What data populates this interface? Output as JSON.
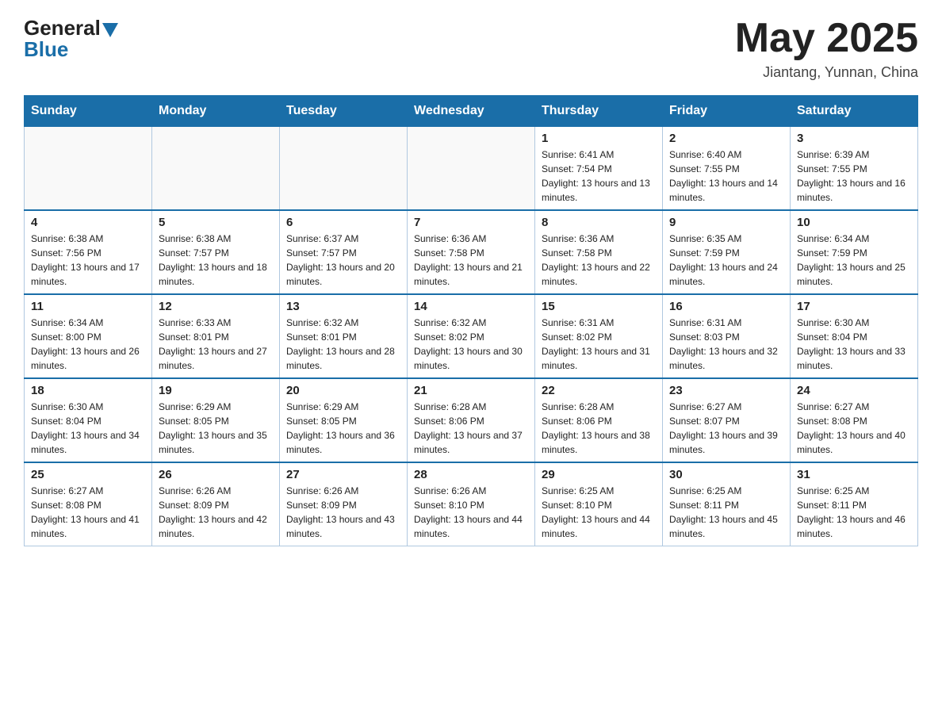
{
  "header": {
    "logo_general": "General",
    "logo_blue": "Blue",
    "month_title": "May 2025",
    "location": "Jiantang, Yunnan, China"
  },
  "days_of_week": [
    "Sunday",
    "Monday",
    "Tuesday",
    "Wednesday",
    "Thursday",
    "Friday",
    "Saturday"
  ],
  "weeks": [
    [
      {
        "day": "",
        "info": ""
      },
      {
        "day": "",
        "info": ""
      },
      {
        "day": "",
        "info": ""
      },
      {
        "day": "",
        "info": ""
      },
      {
        "day": "1",
        "info": "Sunrise: 6:41 AM\nSunset: 7:54 PM\nDaylight: 13 hours and 13 minutes."
      },
      {
        "day": "2",
        "info": "Sunrise: 6:40 AM\nSunset: 7:55 PM\nDaylight: 13 hours and 14 minutes."
      },
      {
        "day": "3",
        "info": "Sunrise: 6:39 AM\nSunset: 7:55 PM\nDaylight: 13 hours and 16 minutes."
      }
    ],
    [
      {
        "day": "4",
        "info": "Sunrise: 6:38 AM\nSunset: 7:56 PM\nDaylight: 13 hours and 17 minutes."
      },
      {
        "day": "5",
        "info": "Sunrise: 6:38 AM\nSunset: 7:57 PM\nDaylight: 13 hours and 18 minutes."
      },
      {
        "day": "6",
        "info": "Sunrise: 6:37 AM\nSunset: 7:57 PM\nDaylight: 13 hours and 20 minutes."
      },
      {
        "day": "7",
        "info": "Sunrise: 6:36 AM\nSunset: 7:58 PM\nDaylight: 13 hours and 21 minutes."
      },
      {
        "day": "8",
        "info": "Sunrise: 6:36 AM\nSunset: 7:58 PM\nDaylight: 13 hours and 22 minutes."
      },
      {
        "day": "9",
        "info": "Sunrise: 6:35 AM\nSunset: 7:59 PM\nDaylight: 13 hours and 24 minutes."
      },
      {
        "day": "10",
        "info": "Sunrise: 6:34 AM\nSunset: 7:59 PM\nDaylight: 13 hours and 25 minutes."
      }
    ],
    [
      {
        "day": "11",
        "info": "Sunrise: 6:34 AM\nSunset: 8:00 PM\nDaylight: 13 hours and 26 minutes."
      },
      {
        "day": "12",
        "info": "Sunrise: 6:33 AM\nSunset: 8:01 PM\nDaylight: 13 hours and 27 minutes."
      },
      {
        "day": "13",
        "info": "Sunrise: 6:32 AM\nSunset: 8:01 PM\nDaylight: 13 hours and 28 minutes."
      },
      {
        "day": "14",
        "info": "Sunrise: 6:32 AM\nSunset: 8:02 PM\nDaylight: 13 hours and 30 minutes."
      },
      {
        "day": "15",
        "info": "Sunrise: 6:31 AM\nSunset: 8:02 PM\nDaylight: 13 hours and 31 minutes."
      },
      {
        "day": "16",
        "info": "Sunrise: 6:31 AM\nSunset: 8:03 PM\nDaylight: 13 hours and 32 minutes."
      },
      {
        "day": "17",
        "info": "Sunrise: 6:30 AM\nSunset: 8:04 PM\nDaylight: 13 hours and 33 minutes."
      }
    ],
    [
      {
        "day": "18",
        "info": "Sunrise: 6:30 AM\nSunset: 8:04 PM\nDaylight: 13 hours and 34 minutes."
      },
      {
        "day": "19",
        "info": "Sunrise: 6:29 AM\nSunset: 8:05 PM\nDaylight: 13 hours and 35 minutes."
      },
      {
        "day": "20",
        "info": "Sunrise: 6:29 AM\nSunset: 8:05 PM\nDaylight: 13 hours and 36 minutes."
      },
      {
        "day": "21",
        "info": "Sunrise: 6:28 AM\nSunset: 8:06 PM\nDaylight: 13 hours and 37 minutes."
      },
      {
        "day": "22",
        "info": "Sunrise: 6:28 AM\nSunset: 8:06 PM\nDaylight: 13 hours and 38 minutes."
      },
      {
        "day": "23",
        "info": "Sunrise: 6:27 AM\nSunset: 8:07 PM\nDaylight: 13 hours and 39 minutes."
      },
      {
        "day": "24",
        "info": "Sunrise: 6:27 AM\nSunset: 8:08 PM\nDaylight: 13 hours and 40 minutes."
      }
    ],
    [
      {
        "day": "25",
        "info": "Sunrise: 6:27 AM\nSunset: 8:08 PM\nDaylight: 13 hours and 41 minutes."
      },
      {
        "day": "26",
        "info": "Sunrise: 6:26 AM\nSunset: 8:09 PM\nDaylight: 13 hours and 42 minutes."
      },
      {
        "day": "27",
        "info": "Sunrise: 6:26 AM\nSunset: 8:09 PM\nDaylight: 13 hours and 43 minutes."
      },
      {
        "day": "28",
        "info": "Sunrise: 6:26 AM\nSunset: 8:10 PM\nDaylight: 13 hours and 44 minutes."
      },
      {
        "day": "29",
        "info": "Sunrise: 6:25 AM\nSunset: 8:10 PM\nDaylight: 13 hours and 44 minutes."
      },
      {
        "day": "30",
        "info": "Sunrise: 6:25 AM\nSunset: 8:11 PM\nDaylight: 13 hours and 45 minutes."
      },
      {
        "day": "31",
        "info": "Sunrise: 6:25 AM\nSunset: 8:11 PM\nDaylight: 13 hours and 46 minutes."
      }
    ]
  ]
}
